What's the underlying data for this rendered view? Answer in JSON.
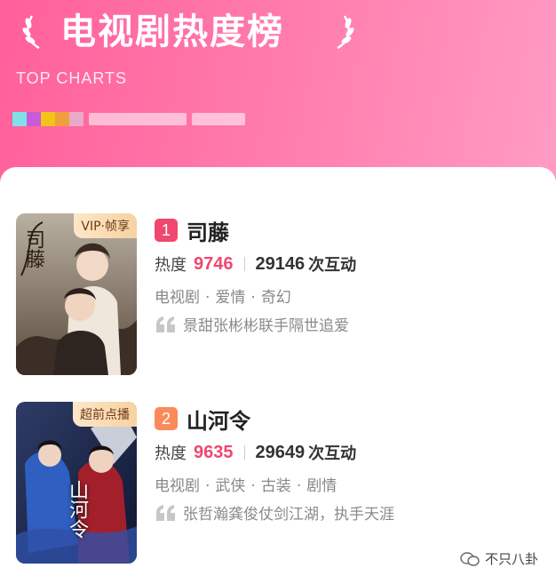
{
  "header": {
    "title": "电视剧热度榜",
    "subtitle": "TOP CHARTS"
  },
  "list": [
    {
      "rank": "1",
      "rank_color": "#f0476f",
      "badge": "VIP·帧享",
      "poster_text": "司藤",
      "title": "司藤",
      "heat_label": "热度",
      "heat": "9746",
      "interactions": "29146",
      "interactions_label": "次互动",
      "tags": [
        "电视剧",
        "爱情",
        "奇幻"
      ],
      "tag_sep": "·",
      "quote": "景甜张彬彬联手隔世追爱"
    },
    {
      "rank": "2",
      "rank_color": "#fb8a5a",
      "badge": "超前点播",
      "poster_text": "山河令",
      "title": "山河令",
      "heat_label": "热度",
      "heat": "9635",
      "interactions": "29649",
      "interactions_label": "次互动",
      "tags": [
        "电视剧",
        "武侠",
        "古装",
        "剧情"
      ],
      "tag_sep": "·",
      "quote": "张哲瀚龚俊仗剑江湖，执手天涯"
    }
  ],
  "watermark": {
    "text": "不只八卦",
    "icon": "wechat-icon"
  },
  "colors": {
    "accent": "#f0476f",
    "header_start": "#ff5f9a",
    "header_end": "#ff9cc4"
  }
}
